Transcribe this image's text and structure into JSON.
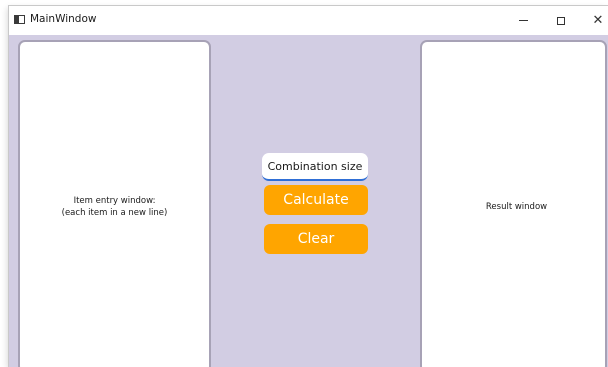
{
  "window": {
    "title": "MainWindow",
    "controls": {
      "minimize": "–",
      "close": "✕"
    }
  },
  "left_panel": {
    "label": "Item entry window:\n(each item in a new line)"
  },
  "center": {
    "combination_size_placeholder": "Combination size",
    "calculate_label": "Calculate",
    "clear_label": "Clear"
  },
  "right_panel": {
    "label": "Result window"
  },
  "colors": {
    "background": "#d2cde3",
    "accent_button": "#ffa500",
    "button_text": "#ffffff",
    "focus_underline": "#2f6fd6"
  }
}
